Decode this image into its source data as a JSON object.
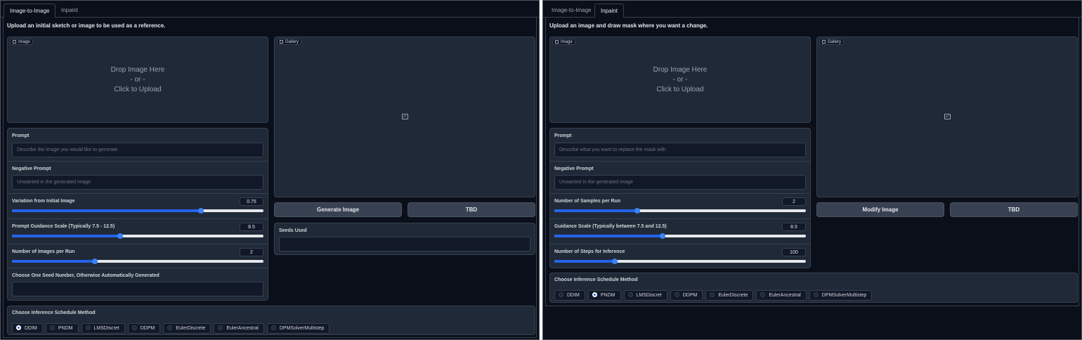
{
  "colors": {
    "background": "#0b0f19",
    "panel": "#1f2937",
    "accent": "#2563eb",
    "border": "#374151"
  },
  "left": {
    "tabs": [
      {
        "label": "Image-to-Image",
        "active": true
      },
      {
        "label": "Inpaint",
        "active": false
      }
    ],
    "description": "Upload an initial sketch or image to be used as a reference.",
    "image_block": {
      "label": "Image",
      "drop_line1": "Drop Image Here",
      "drop_line2": "- or -",
      "drop_line3": "Click to Upload"
    },
    "gallery_block": {
      "label": "Gallery",
      "icon": "image-icon"
    },
    "prompt": {
      "label": "Prompt",
      "placeholder": "Describe the image you would like to generate"
    },
    "negative_prompt": {
      "label": "Negative Prompt",
      "placeholder": "Unwanted in the generated image"
    },
    "variation": {
      "label": "Variation from Initial Image",
      "value": "0.75",
      "fraction": 0.75
    },
    "guidance": {
      "label": "Prompt Guidance Scale (Typically 7.5 - 12.5)",
      "value": "8.5",
      "fraction": 0.43
    },
    "images_per_run": {
      "label": "Number of Images per Run",
      "value": "2",
      "fraction": 0.33
    },
    "seed": {
      "label": "Choose One Seed Number, Otherwise Automatically Generated",
      "value": ""
    },
    "generate_button": "Generate Image",
    "tbd_button": "TBD",
    "seeds_used": {
      "label": "Seeds Used",
      "value": ""
    },
    "schedule": {
      "label": "Choose Inference Schedule Method",
      "options": [
        "DDIM",
        "PNDM",
        "LMSDiscret",
        "DDPM",
        "EulerDiscrete",
        "EulerAncestral",
        "DPMSolverMultistep"
      ],
      "selected": "DDIM"
    }
  },
  "right": {
    "tabs": [
      {
        "label": "Image-to-Image",
        "active": false
      },
      {
        "label": "Inpaint",
        "active": true
      }
    ],
    "description": "Upload an image and draw mask where you want a change.",
    "image_block": {
      "label": "Image",
      "drop_line1": "Drop Image Here",
      "drop_line2": "- or -",
      "drop_line3": "Click to Upload"
    },
    "gallery_block": {
      "label": "Gallery",
      "icon": "image-icon"
    },
    "prompt": {
      "label": "Prompt",
      "placeholder": "Describe what you want to replace the mask with"
    },
    "negative_prompt": {
      "label": "Negative Prompt",
      "placeholder": "Unwanted in the generated image"
    },
    "samples_per_run": {
      "label": "Number of Samples per Run",
      "value": "2",
      "fraction": 0.33
    },
    "guidance": {
      "label": "Guidance Scale (Typically between 7.5 and 12.5)",
      "value": "8.5",
      "fraction": 0.43
    },
    "steps": {
      "label": "Number of Steps for Inference",
      "value": "100",
      "fraction": 0.24
    },
    "modify_button": "Modify Image",
    "tbd_button": "TBD",
    "schedule": {
      "label": "Choose Inference Schedule Method",
      "options": [
        "DDIM",
        "PNDM",
        "LMSDiscret",
        "DDPM",
        "EulerDiscrete",
        "EulerAncestral",
        "DPMSolverMultistep"
      ],
      "selected": "PNDM"
    }
  }
}
